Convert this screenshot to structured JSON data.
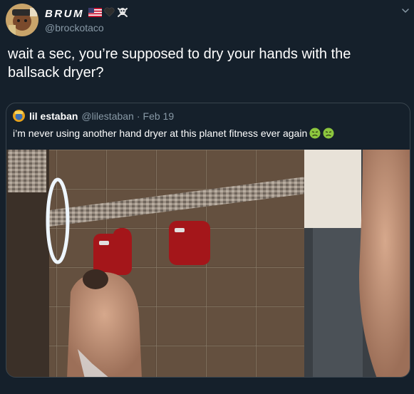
{
  "tweet": {
    "display_name": "BRUM",
    "handle": "@brockotaco",
    "text": "wait a sec, you’re supposed to dry your hands with the ballsack dryer?",
    "name_icons": [
      "us-flag-icon",
      "black-heart-icon",
      "skull-crossbones-icon"
    ]
  },
  "quote": {
    "display_name": "lil estaban",
    "handle": "@lilestaban",
    "separator": "·",
    "date": "Feb 19",
    "text": "i’m never using another hand dryer at this planet fitness ever again",
    "emoji": [
      "nauseated-face-icon",
      "nauseated-face-icon"
    ]
  },
  "colors": {
    "background": "#15202b",
    "border": "#38444d",
    "secondary_text": "#8899a6",
    "primary_text": "#ffffff"
  }
}
